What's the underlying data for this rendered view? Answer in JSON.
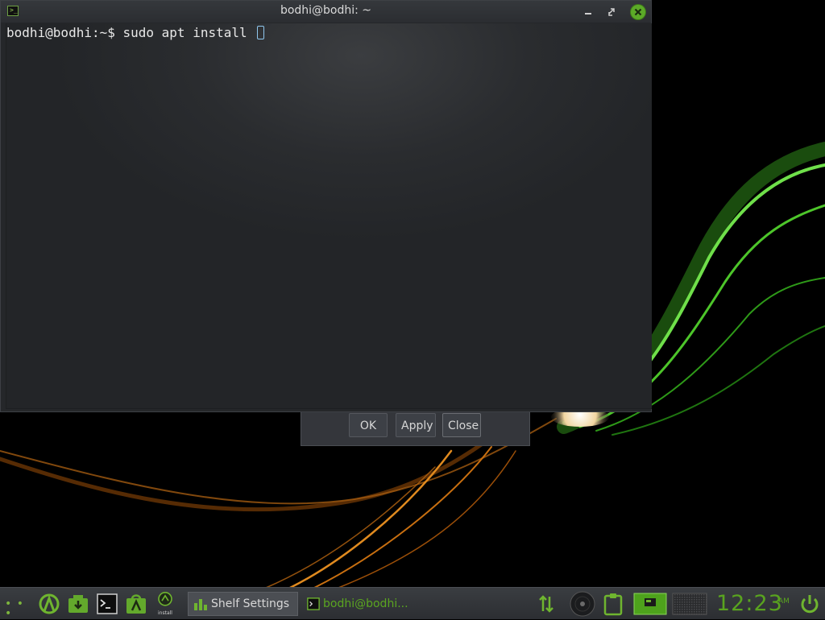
{
  "terminal": {
    "title": "bodhi@bodhi: ~",
    "prompt": "bodhi@bodhi:~$ ",
    "command": "sudo apt install "
  },
  "dialog": {
    "ok_label": "OK",
    "apply_label": "Apply",
    "close_label": "Close"
  },
  "shelf": {
    "tasks": [
      {
        "label": "Shelf Settings"
      },
      {
        "label": "bodhi@bodhi..."
      }
    ],
    "launchers": [
      "menu-dots-icon",
      "bodhi-app-center-icon",
      "downloads-icon",
      "terminal-icon",
      "appcenter-store-icon",
      "install-icon"
    ],
    "install_label": "install",
    "clock": {
      "time": "12:23",
      "ampm": "AM"
    }
  },
  "colors": {
    "accent": "#5caa28",
    "terminal_bg": "#2a2c2f",
    "shelf_bg": "#34373b"
  }
}
